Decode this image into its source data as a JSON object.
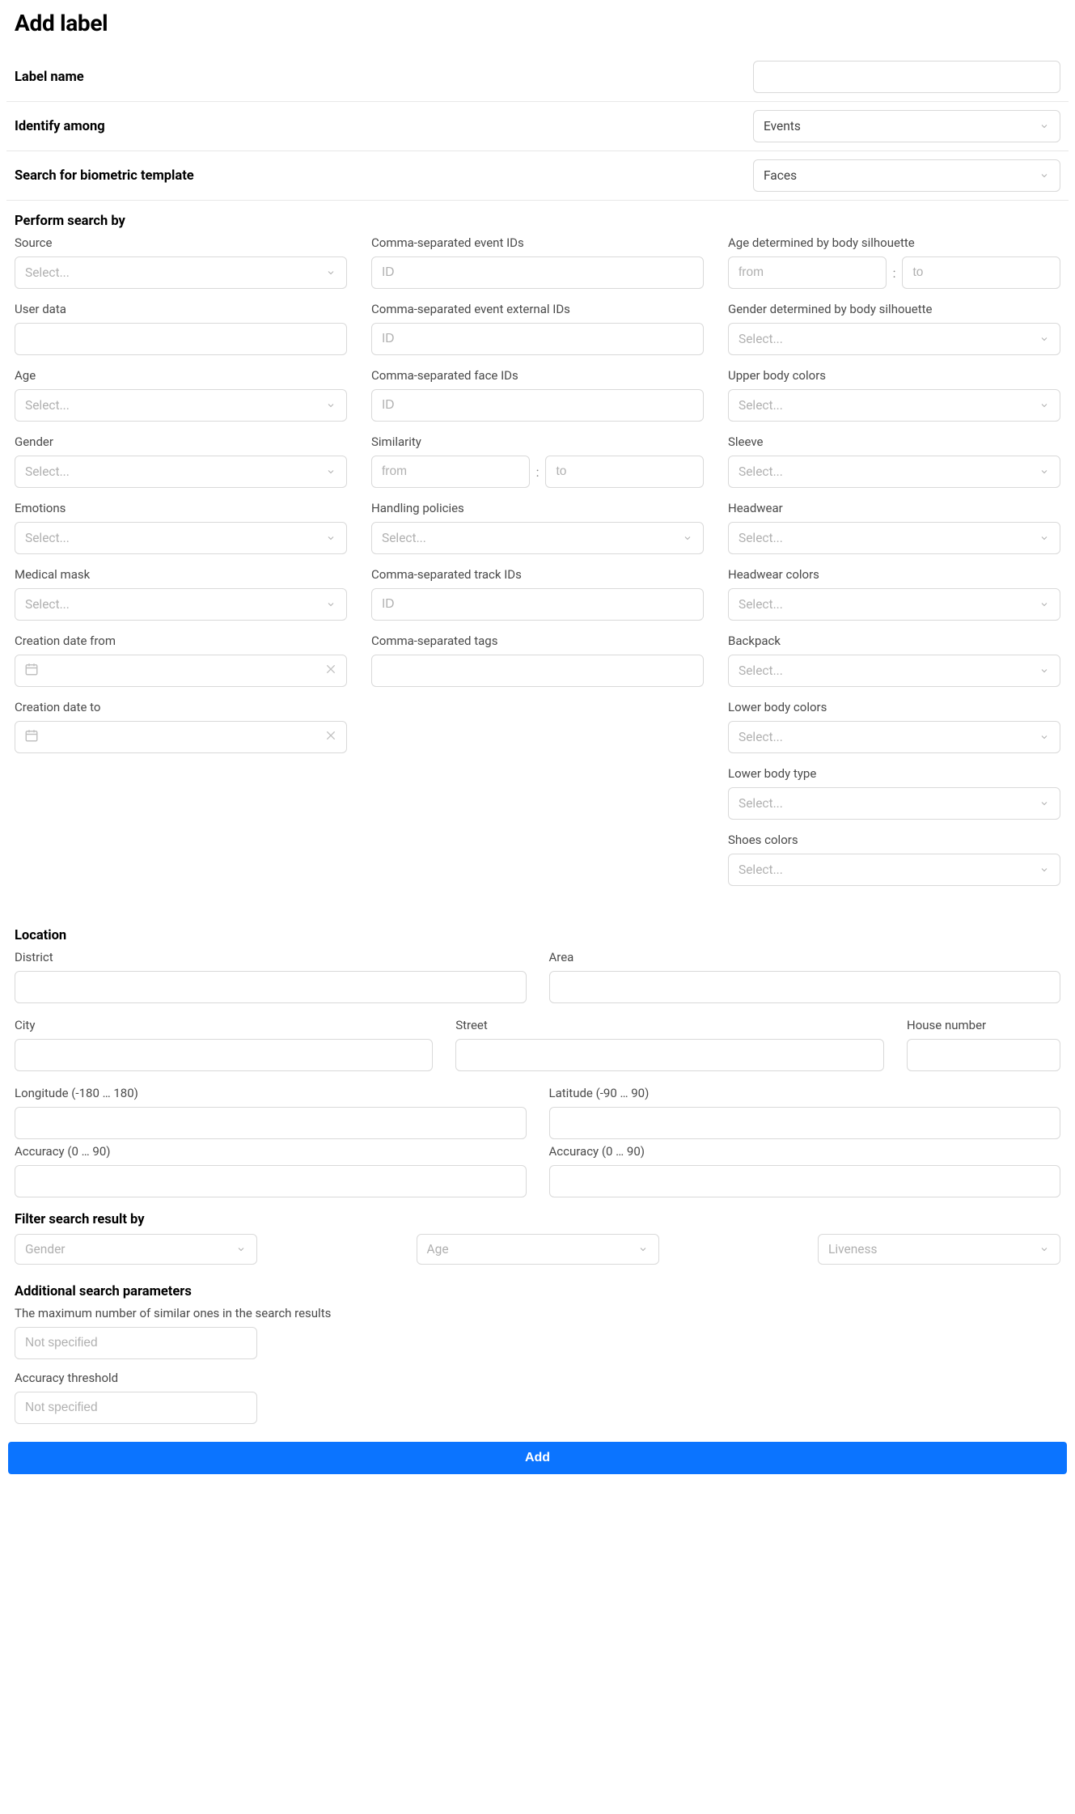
{
  "title": "Add label",
  "label_name": {
    "label": "Label name",
    "value": ""
  },
  "identify": {
    "label": "Identify among",
    "value": "Events"
  },
  "biometric": {
    "label": "Search for biometric template",
    "value": "Faces"
  },
  "perform_heading": "Perform search by",
  "col1": {
    "source": {
      "label": "Source",
      "placeholder": "Select..."
    },
    "user_data": {
      "label": "User data",
      "value": ""
    },
    "age": {
      "label": "Age",
      "placeholder": "Select..."
    },
    "gender": {
      "label": "Gender",
      "placeholder": "Select..."
    },
    "emotions": {
      "label": "Emotions",
      "placeholder": "Select..."
    },
    "medical_mask": {
      "label": "Medical mask",
      "placeholder": "Select..."
    },
    "creation_from": {
      "label": "Creation date from",
      "value": ""
    },
    "creation_to": {
      "label": "Creation date to",
      "value": ""
    }
  },
  "col2": {
    "event_ids": {
      "label": "Comma-separated event IDs",
      "placeholder": "ID"
    },
    "event_ext_ids": {
      "label": "Comma-separated event external IDs",
      "placeholder": "ID"
    },
    "face_ids": {
      "label": "Comma-separated face IDs",
      "placeholder": "ID"
    },
    "similarity": {
      "label": "Similarity",
      "from": "from",
      "to": "to"
    },
    "handling": {
      "label": "Handling policies",
      "placeholder": "Select..."
    },
    "track_ids": {
      "label": "Comma-separated track IDs",
      "placeholder": "ID"
    },
    "tags": {
      "label": "Comma-separated tags",
      "value": ""
    }
  },
  "col3": {
    "age_body": {
      "label": "Age determined by body silhouette",
      "from": "from",
      "to": "to"
    },
    "gender_body": {
      "label": "Gender determined by body silhouette",
      "placeholder": "Select..."
    },
    "upper_colors": {
      "label": "Upper body colors",
      "placeholder": "Select..."
    },
    "sleeve": {
      "label": "Sleeve",
      "placeholder": "Select..."
    },
    "headwear": {
      "label": "Headwear",
      "placeholder": "Select..."
    },
    "headwear_colors": {
      "label": "Headwear colors",
      "placeholder": "Select..."
    },
    "backpack": {
      "label": "Backpack",
      "placeholder": "Select..."
    },
    "lower_colors": {
      "label": "Lower body colors",
      "placeholder": "Select..."
    },
    "lower_type": {
      "label": "Lower body type",
      "placeholder": "Select..."
    },
    "shoes": {
      "label": "Shoes colors",
      "placeholder": "Select..."
    }
  },
  "location": {
    "heading": "Location",
    "district": "District",
    "area": "Area",
    "city": "City",
    "street": "Street",
    "house": "House number",
    "longitude": "Longitude (-180 … 180)",
    "latitude": "Latitude (-90 … 90)",
    "lon_accuracy": "Accuracy (0 … 90)",
    "lat_accuracy": "Accuracy (0 … 90)"
  },
  "filter": {
    "heading": "Filter search result by",
    "gender": "Gender",
    "age": "Age",
    "liveness": "Liveness"
  },
  "additional": {
    "heading": "Additional search parameters",
    "max_similar": {
      "label": "The maximum number of similar ones in the search results",
      "placeholder": "Not specified"
    },
    "threshold": {
      "label": "Accuracy threshold",
      "placeholder": "Not specified"
    }
  },
  "add_button": "Add"
}
